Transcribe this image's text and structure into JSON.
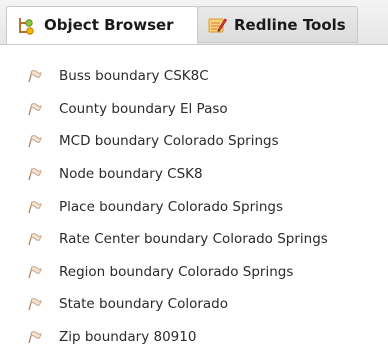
{
  "tabs": [
    {
      "label": "Object Browser",
      "icon": "object-browser-icon",
      "active": true
    },
    {
      "label": "Redline Tools",
      "icon": "redline-tools-icon",
      "active": false
    }
  ],
  "items": [
    {
      "label": "Buss boundary CSK8C",
      "icon": "flag-pin-icon"
    },
    {
      "label": "County boundary El Paso",
      "icon": "flag-pin-icon"
    },
    {
      "label": "MCD boundary Colorado Springs",
      "icon": "flag-pin-icon"
    },
    {
      "label": "Node boundary CSK8",
      "icon": "flag-pin-icon"
    },
    {
      "label": "Place boundary Colorado Springs",
      "icon": "flag-pin-icon"
    },
    {
      "label": "Rate Center boundary Colorado Springs",
      "icon": "flag-pin-icon"
    },
    {
      "label": "Region boundary Colorado Springs",
      "icon": "flag-pin-icon"
    },
    {
      "label": "State boundary Colorado",
      "icon": "flag-pin-icon"
    },
    {
      "label": "Zip boundary 80910",
      "icon": "flag-pin-icon"
    }
  ],
  "colors": {
    "tab_bar": "#e6e6e6",
    "active_tab": "#ffffff",
    "text": "#2b2b2b",
    "flag_icon": "#c9a58a"
  }
}
